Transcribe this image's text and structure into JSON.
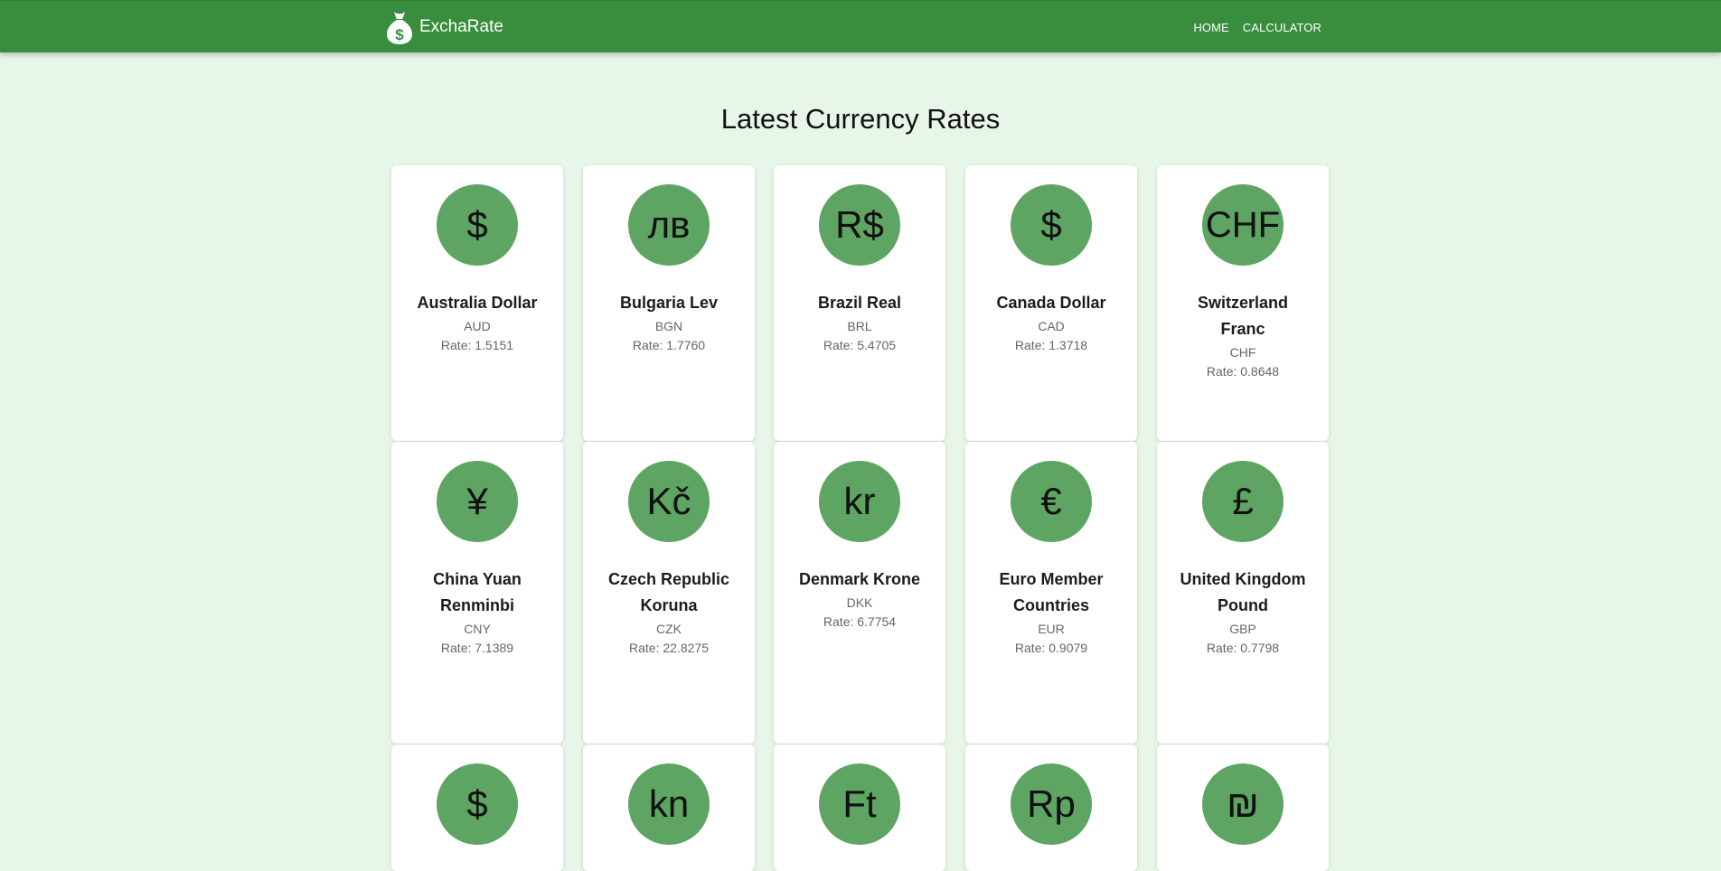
{
  "brand": {
    "name": "ExchaRate",
    "icon": "money-bag-icon"
  },
  "nav": {
    "home": "HOME",
    "calculator": "CALCULATOR"
  },
  "page": {
    "title": "Latest Currency Rates"
  },
  "colors": {
    "navbar": "#388e3c",
    "background": "#e8f5e9",
    "coin": "#5ea462",
    "card": "#ffffff"
  },
  "currencies": [
    {
      "symbol": "$",
      "name": "Australia Dollar",
      "code": "AUD",
      "rate": "Rate: 1.5151"
    },
    {
      "symbol": "лв",
      "name": "Bulgaria Lev",
      "code": "BGN",
      "rate": "Rate: 1.7760"
    },
    {
      "symbol": "R$",
      "name": "Brazil Real",
      "code": "BRL",
      "rate": "Rate: 5.4705"
    },
    {
      "symbol": "$",
      "name": "Canada Dollar",
      "code": "CAD",
      "rate": "Rate: 1.3718"
    },
    {
      "symbol": "CHF",
      "name": "Switzerland Franc",
      "code": "CHF",
      "rate": "Rate: 0.8648"
    },
    {
      "symbol": "¥",
      "name": "China Yuan Renminbi",
      "code": "CNY",
      "rate": "Rate: 7.1389"
    },
    {
      "symbol": "Kč",
      "name": "Czech Republic Koruna",
      "code": "CZK",
      "rate": "Rate: 22.8275"
    },
    {
      "symbol": "kr",
      "name": "Denmark Krone",
      "code": "DKK",
      "rate": "Rate: 6.7754"
    },
    {
      "symbol": "€",
      "name": "Euro Member Countries",
      "code": "EUR",
      "rate": "Rate: 0.9079"
    },
    {
      "symbol": "£",
      "name": "United Kingdom Pound",
      "code": "GBP",
      "rate": "Rate: 0.7798"
    },
    {
      "symbol": "$"
    },
    {
      "symbol": "kn"
    },
    {
      "symbol": "Ft"
    },
    {
      "symbol": "Rp"
    },
    {
      "symbol": "₪"
    }
  ]
}
